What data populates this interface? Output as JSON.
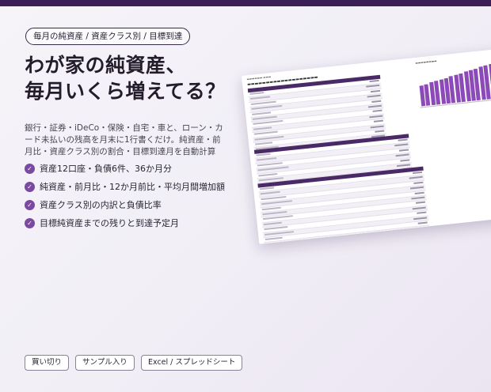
{
  "tag": "毎月の純資産 / 資産クラス別 / 目標到達",
  "headline": [
    "わが家の純資産、",
    "毎月いくら増えてる？"
  ],
  "description": "銀行・証券・iDeCo・保険・自宅・車と、ローン・カード未払いの残高を月末に1行書くだけ。純資産・前月比・資産クラス別の割合・目標到達月を自動計算",
  "features": [
    "資産12口座・負債6件、36か月分",
    "純資産・前月比・12か月前比・平均月間増加額",
    "資産クラス別の内訳と負債比率",
    "目標純資産までの残りと到達予定月"
  ],
  "badges": [
    "買い切り",
    "サンプル入り",
    "Excel / スプレッドシート"
  ],
  "colors": {
    "accent": "#3a1f56",
    "check": "#7a4aa0",
    "bar": "#8c49b8"
  },
  "icons": {
    "feature": "check-circle-icon"
  }
}
